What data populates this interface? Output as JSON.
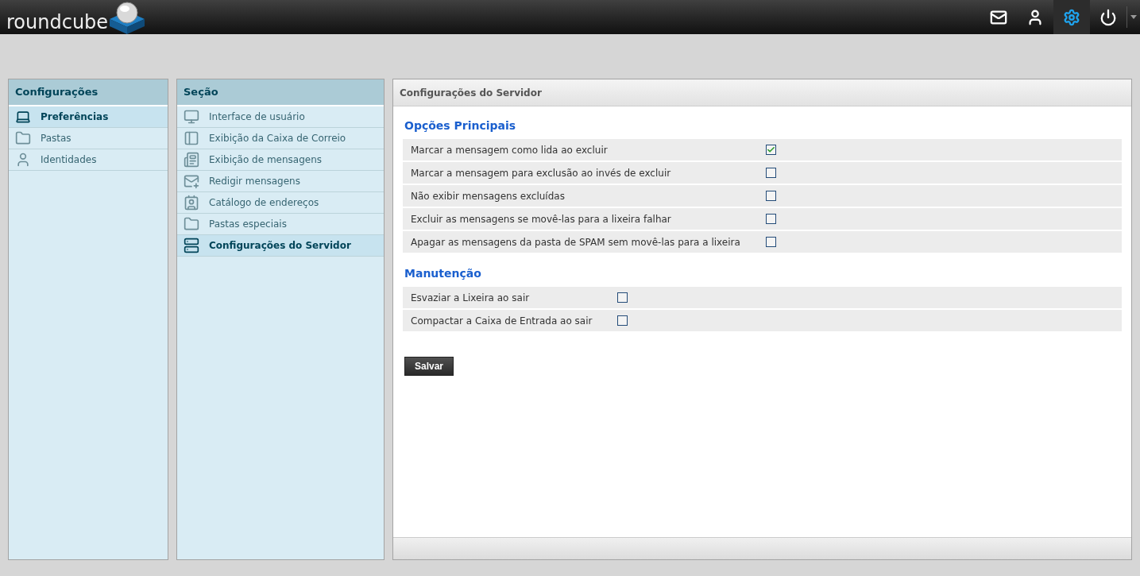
{
  "logo": {
    "text": "roundcube"
  },
  "top_nav": [
    {
      "kind": "mail",
      "selected": false
    },
    {
      "kind": "contacts",
      "selected": false
    },
    {
      "kind": "settings",
      "selected": true
    },
    {
      "kind": "logout",
      "selected": false
    }
  ],
  "settings_panel": {
    "title": "Configurações",
    "items": [
      {
        "label": "Preferências",
        "kind": "laptop",
        "selected": true
      },
      {
        "label": "Pastas",
        "kind": "folder",
        "selected": false
      },
      {
        "label": "Identidades",
        "kind": "person",
        "selected": false
      }
    ]
  },
  "section_panel": {
    "title": "Seção",
    "items": [
      {
        "label": "Interface de usuário",
        "kind": "monitor",
        "selected": false
      },
      {
        "label": "Exibição da Caixa de Correio",
        "kind": "list",
        "selected": false
      },
      {
        "label": "Exibição de mensagens",
        "kind": "message",
        "selected": false
      },
      {
        "label": "Redigir mensagens",
        "kind": "compose",
        "selected": false
      },
      {
        "label": "Catálogo de endereços",
        "kind": "addressbook",
        "selected": false
      },
      {
        "label": "Pastas especiais",
        "kind": "folder",
        "selected": false
      },
      {
        "label": "Configurações do Servidor",
        "kind": "server",
        "selected": true
      }
    ]
  },
  "main": {
    "title": "Configurações do Servidor",
    "groups": [
      {
        "title": "Opções Principais",
        "options": [
          {
            "label": "Marcar a mensagem como lida ao excluir",
            "checked": true
          },
          {
            "label": "Marcar a mensagem para exclusão ao invés de excluir",
            "checked": false
          },
          {
            "label": "Não exibir mensagens excluídas",
            "checked": false
          },
          {
            "label": "Excluir as mensagens se movê-las para a lixeira falhar",
            "checked": false
          },
          {
            "label": "Apagar as mensagens da pasta de SPAM sem movê-las para a lixeira",
            "checked": false
          }
        ]
      },
      {
        "title": "Manutenção",
        "options": [
          {
            "label": "Esvaziar a Lixeira ao sair",
            "checked": false
          },
          {
            "label": "Compactar a Caixa de Entrada ao sair",
            "checked": false
          }
        ]
      }
    ],
    "save_button": "Salvar"
  }
}
